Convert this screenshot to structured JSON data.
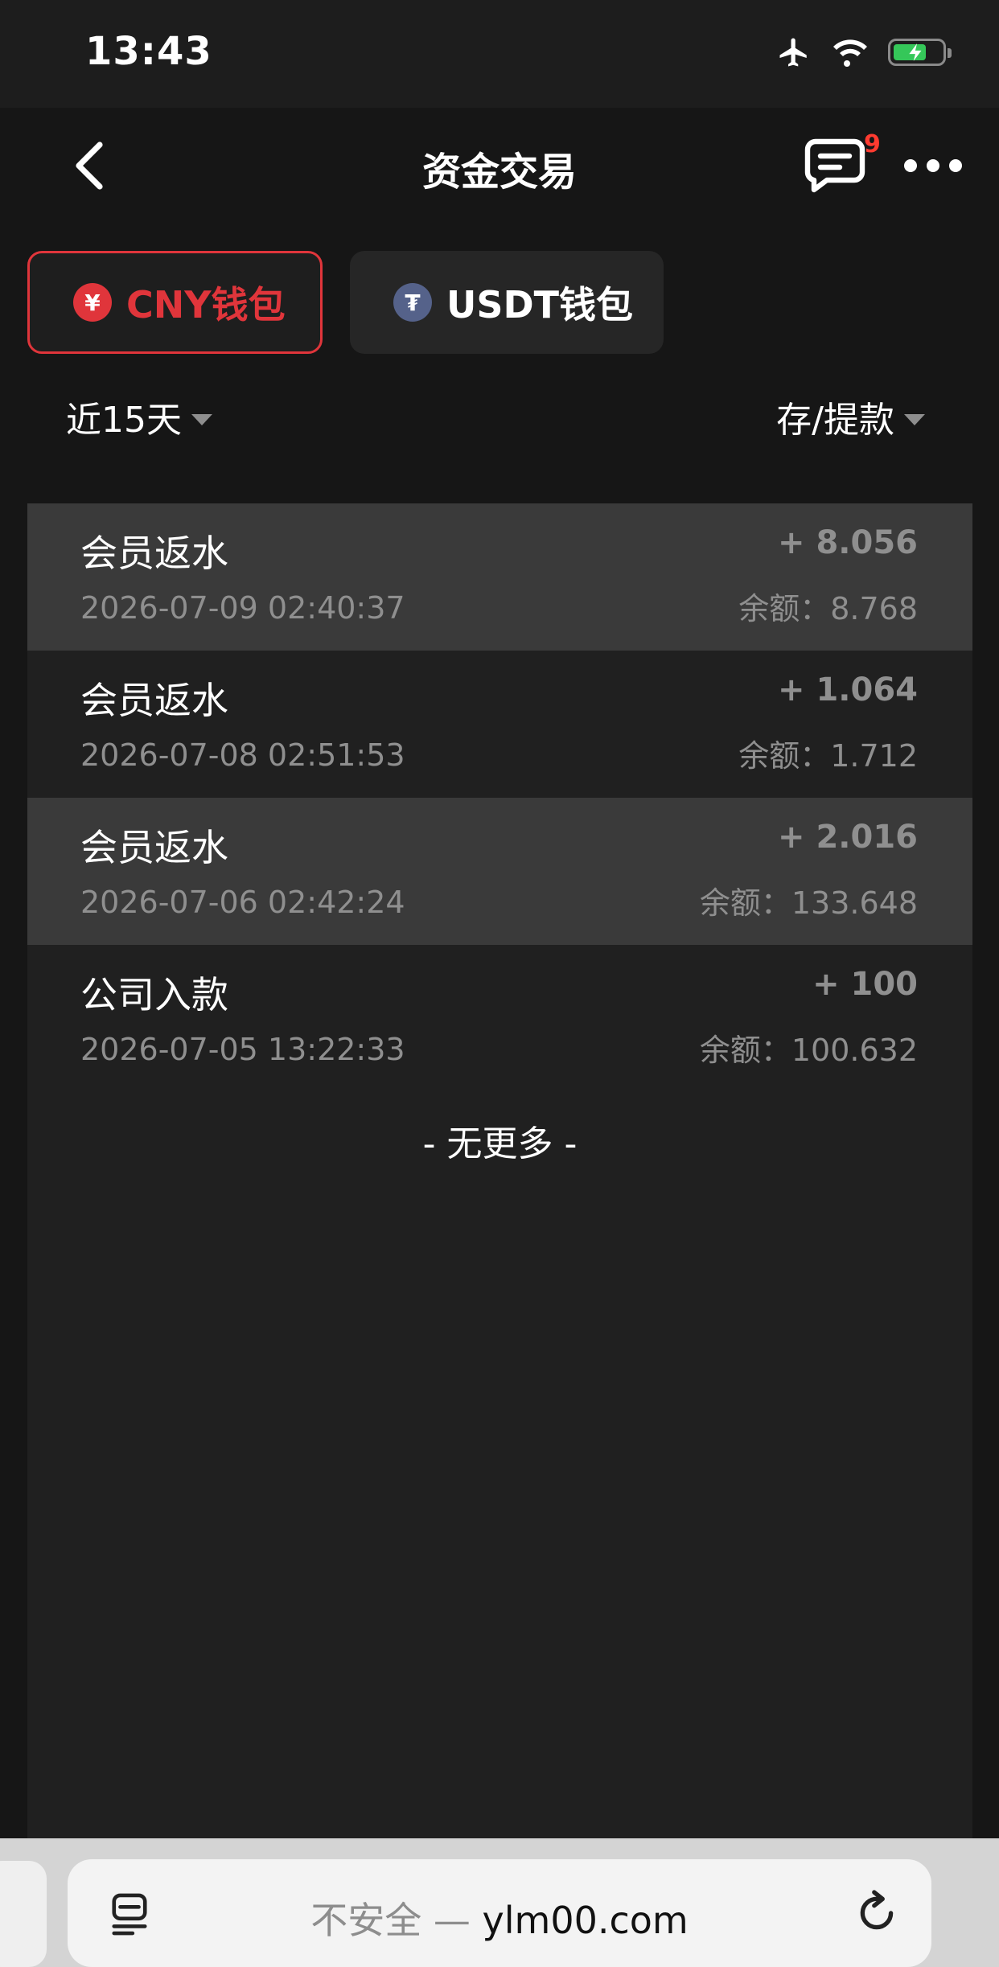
{
  "status_bar": {
    "time": "13:43"
  },
  "nav": {
    "title": "资金交易",
    "message_badge": "9"
  },
  "wallet_tabs": [
    {
      "label": "CNY钱包",
      "icon_glyph": "¥",
      "active": true
    },
    {
      "label": "USDT钱包",
      "icon_glyph": "₮",
      "active": false
    }
  ],
  "filters": {
    "period": "近15天",
    "type": "存/提款"
  },
  "transactions": [
    {
      "title": "会员返水",
      "time": "2026-07-09 02:40:37",
      "amount": "+ 8.056",
      "balance": "余额：8.768",
      "highlight": true
    },
    {
      "title": "会员返水",
      "time": "2026-07-08 02:51:53",
      "amount": "+ 1.064",
      "balance": "余额：1.712",
      "highlight": false
    },
    {
      "title": "会员返水",
      "time": "2026-07-06 02:42:24",
      "amount": "+ 2.016",
      "balance": "余额：133.648",
      "highlight": true
    },
    {
      "title": "公司入款",
      "time": "2026-07-05 13:22:33",
      "amount": "+ 100",
      "balance": "余额：100.632",
      "highlight": false
    }
  ],
  "list_footer": "- 无更多 -",
  "browser": {
    "insecure_label": "不安全 — ",
    "domain": "ylm00.com"
  },
  "colors": {
    "accent_red": "#e0353b",
    "usdt_blue": "#55628a",
    "badge_red": "#ff3b30",
    "battery_green": "#35c759"
  },
  "icons": [
    "airplane-icon",
    "wifi-icon",
    "battery-icon",
    "back-chevron-icon",
    "message-icon",
    "more-icon",
    "yuan-icon",
    "tether-icon",
    "caret-down-icon",
    "reader-icon",
    "reload-icon"
  ]
}
